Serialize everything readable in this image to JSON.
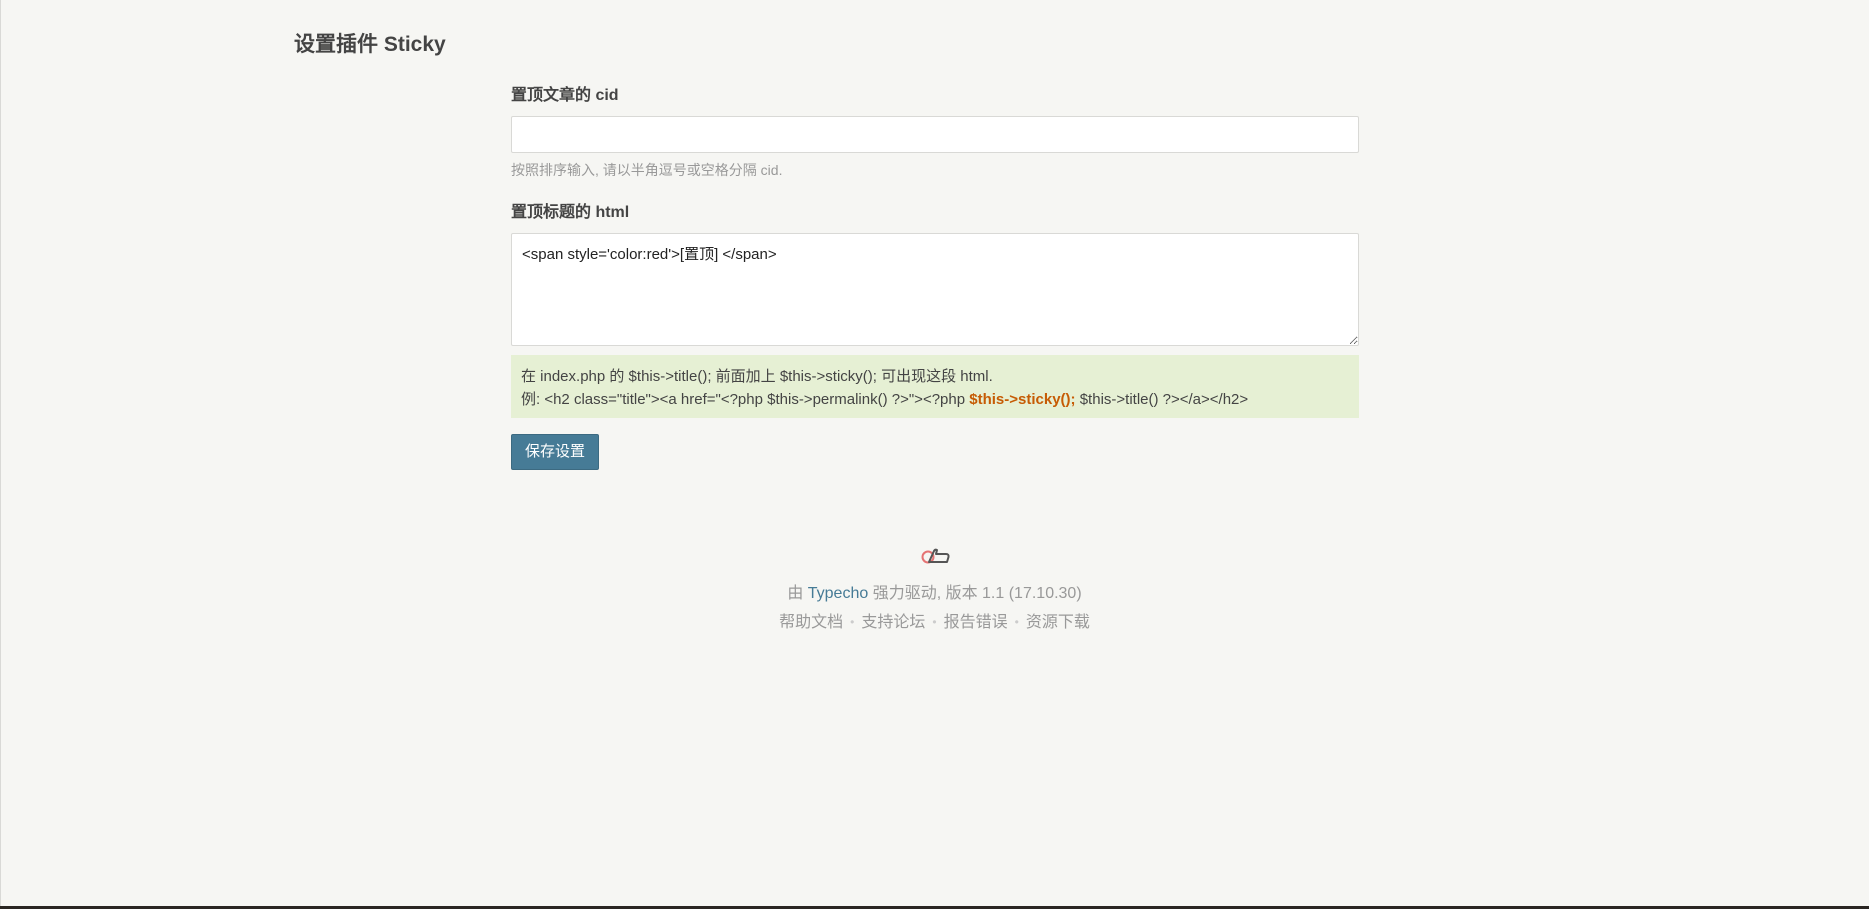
{
  "page": {
    "title": "设置插件 Sticky"
  },
  "form": {
    "cid_label": "置顶文章的 cid",
    "cid_value": "",
    "cid_desc": "按照排序输入, 请以半角逗号或空格分隔 cid.",
    "html_label": "置顶标题的 html",
    "html_value": "<span style='color:red'>[置顶] </span>",
    "info_line1": "在 index.php 的 $this->title(); 前面加上 $this->sticky(); 可出现这段 html.",
    "info_line2_prefix": "例: <h2 class=\"title\"><a href=\"<?php $this->permalink() ?>\"><?php ",
    "info_line2_highlight": "$this->sticky();",
    "info_line2_suffix": " $this->title() ?></a></h2>",
    "save_label": "保存设置"
  },
  "footer": {
    "logo_icon": "typecho-logo-icon",
    "powered_prefix": "由 ",
    "powered_link": "Typecho",
    "powered_suffix": " 强力驱动, 版本 1.1 (17.10.30)",
    "links": [
      "帮助文档",
      "支持论坛",
      "报告错误",
      "资源下载"
    ],
    "separator": "•"
  },
  "colors": {
    "background": "#f6f6f3",
    "button": "#467b96",
    "info_bg": "#e6f0d4",
    "highlight": "#c65b04",
    "link": "#467b96"
  }
}
